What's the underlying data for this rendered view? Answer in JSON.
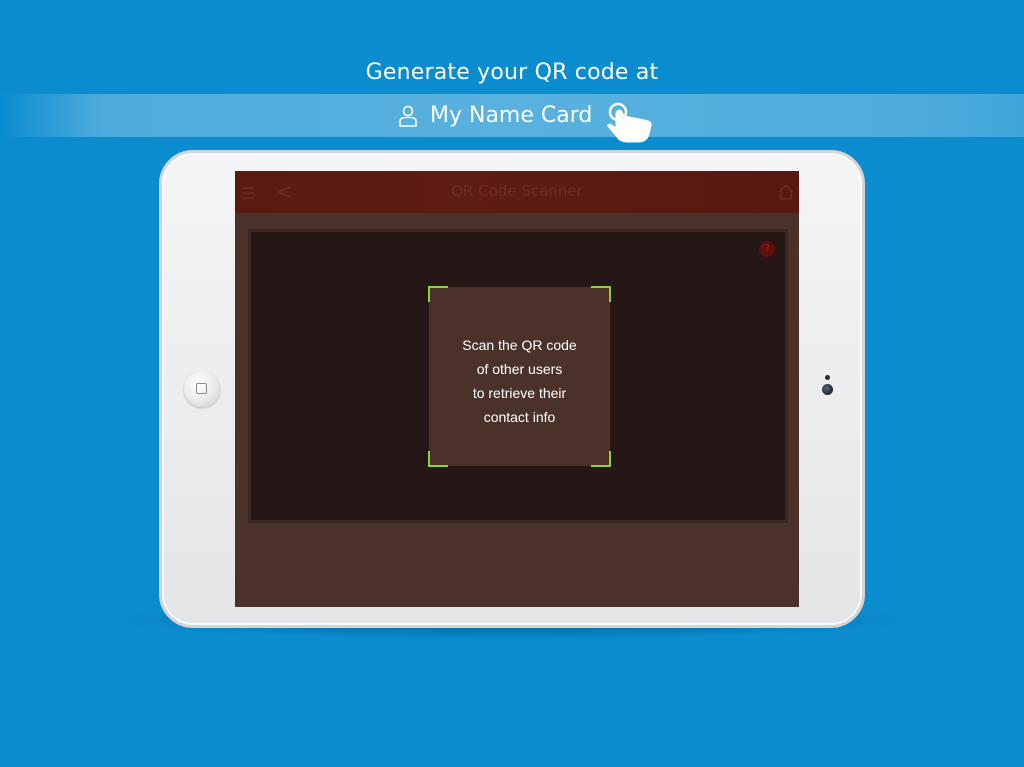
{
  "promo": {
    "headline": "Generate your QR code at",
    "link_label": "My Name Card",
    "person_icon": "person-icon",
    "touch_icon": "tap-hand-icon"
  },
  "app": {
    "header": {
      "menu_glyph": "☰",
      "back_glyph": "<",
      "title": "QR Code Scanner",
      "help_glyph": "?"
    },
    "scanner": {
      "instruction_lines": [
        "Scan the QR code",
        "of other users",
        "to retrieve their",
        "contact info"
      ]
    }
  },
  "colors": {
    "background": "#0a8ccf",
    "header_bg": "#5a1a10",
    "screen_bg": "#4a322b",
    "camera_bg": "#241715",
    "scan_corner": "#8fd13a"
  }
}
